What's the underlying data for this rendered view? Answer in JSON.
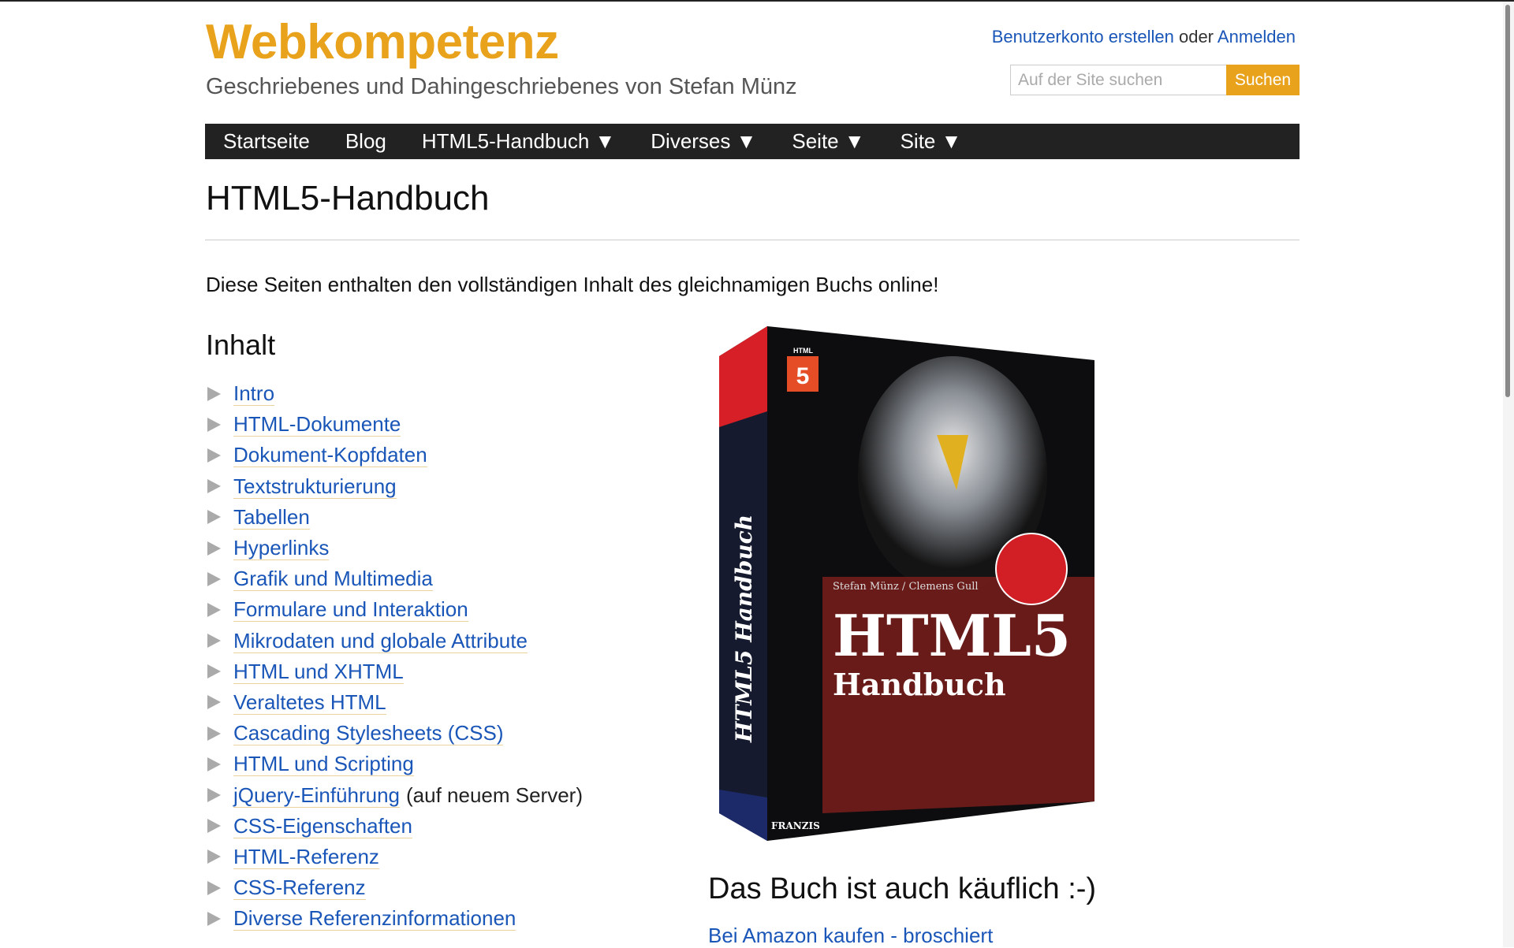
{
  "header": {
    "logo": "Webkompetenz",
    "tagline": "Geschriebenes und Dahingeschriebenes von Stefan Münz",
    "create_account": "Benutzerkonto erstellen",
    "or": "oder",
    "login": "Anmelden",
    "search_placeholder": "Auf der Site suchen",
    "search_button": "Suchen"
  },
  "nav": [
    {
      "label": "Startseite"
    },
    {
      "label": "Blog"
    },
    {
      "label": "HTML5-Handbuch ▼"
    },
    {
      "label": "Diverses ▼"
    },
    {
      "label": "Seite ▼"
    },
    {
      "label": "Site ▼"
    }
  ],
  "main": {
    "title": "HTML5-Handbuch",
    "intro": "Diese Seiten enthalten den vollständigen Inhalt des gleichnamigen Buchs online!",
    "toc_heading": "Inhalt",
    "toc": [
      {
        "label": "Intro"
      },
      {
        "label": "HTML-Dokumente"
      },
      {
        "label": "Dokument-Kopfdaten"
      },
      {
        "label": "Textstrukturierung"
      },
      {
        "label": "Tabellen"
      },
      {
        "label": "Hyperlinks"
      },
      {
        "label": "Grafik und Multimedia"
      },
      {
        "label": "Formulare und Interaktion"
      },
      {
        "label": "Mikrodaten und globale Attribute"
      },
      {
        "label": "HTML und XHTML"
      },
      {
        "label": "Veraltetes HTML"
      },
      {
        "label": "Cascading Stylesheets (CSS)"
      },
      {
        "label": "HTML und Scripting"
      },
      {
        "label": "jQuery-Einführung",
        "extra": "(auf neuem Server)"
      },
      {
        "label": "CSS-Eigenschaften"
      },
      {
        "label": "HTML-Referenz"
      },
      {
        "label": "CSS-Referenz"
      },
      {
        "label": "Diverse Referenzinformationen"
      }
    ],
    "book": {
      "spine": "HTML5 Handbuch",
      "badge": "HTML",
      "title": "HTML5",
      "subtitle": "Handbuch",
      "authors": "Stefan Münz / Clemens Gull",
      "publisher": "FRANZIS"
    },
    "buy_heading": "Das Buch ist auch käuflich :-)",
    "amazon_link": "Bei Amazon kaufen - broschiert"
  },
  "colors": {
    "accent": "#e9a21b",
    "link": "#1a56b8",
    "nav_bg": "#222222"
  }
}
